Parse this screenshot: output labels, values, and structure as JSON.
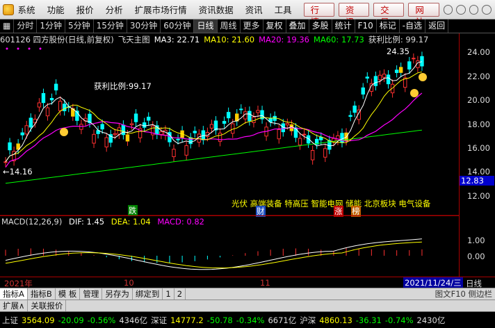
{
  "menu": {
    "items": [
      "系统",
      "功能",
      "报价",
      "分析",
      "扩展市场行情",
      "资讯数据",
      "资讯",
      "工具"
    ],
    "right_buttons": [
      "行情",
      "资讯",
      "交易",
      "网站"
    ]
  },
  "toolbar": {
    "left": [
      "分时",
      "1分钟",
      "5分钟",
      "15分钟",
      "30分钟",
      "60分钟",
      "日线",
      "周线",
      "更多"
    ],
    "active": "日线",
    "right": [
      "复权",
      "叠加",
      "多股",
      "统计",
      "F10",
      "标记",
      "-自选",
      "返回"
    ]
  },
  "info": {
    "stock": "601126 四方股份(日线,前复权)",
    "main_label": "飞天主图",
    "ma3": "MA3: 22.71",
    "ma10": "MA10: 21.60",
    "ma20": "MA20: 19.36",
    "ma60": "MA60: 17.73",
    "profit": "获利比例: 99.17"
  },
  "axis": {
    "y_labels": [
      "24.00",
      "22.00",
      "20.00",
      "18.00",
      "16.00",
      "14.00",
      "12.00"
    ],
    "current_price": "12.83",
    "macd_labels": [
      "1.00",
      "0.00"
    ]
  },
  "annotations": {
    "profit_mid": "获利比例:99.17",
    "low_price": "←14.16",
    "high_price": "24.35",
    "sectors": "光伏 高端装备 特高压 智能电网 储能  北京板块   电气设备",
    "tag_die": "跌",
    "tag_cai": "财",
    "tag_zhang": "涨",
    "tag_bang": "榜"
  },
  "macd": {
    "label": "MACD(12,26,9)",
    "dif": "DIF: 1.45",
    "dea": "DEA: 1.04",
    "macd": "MACD: 0.82"
  },
  "dates": {
    "start": "2021年",
    "m10": "10",
    "m11": "11",
    "current": "2021/11/24/三",
    "period": "日线"
  },
  "tabs": {
    "items": [
      "指标A",
      "指标B",
      "模 板",
      "管理",
      "另存为",
      "绑定到",
      "1",
      "2"
    ],
    "active": "指标A",
    "right_text": "图文F10 侧边栏"
  },
  "tabs2": [
    "扩展∧",
    "关联报价"
  ],
  "status": {
    "sh_label": "上证",
    "sh_price": "3564.09",
    "sh_chg": "-20.09",
    "sh_pct": "-0.56%",
    "sh_vol": "4346亿",
    "sz_label": "深证",
    "sz_price": "14777.2",
    "sz_chg": "-50.78",
    "sz_pct": "-0.34%",
    "sz_vol": "6671亿",
    "hs_label": "沪深",
    "hs_price": "4860.13",
    "hs_chg": "-36.31",
    "hs_pct": "-0.74%",
    "hs_vol": "2430亿"
  },
  "colors": {
    "up": "#ff3030",
    "down": "#00ffff",
    "ma3": "#ffffff",
    "ma10": "#ffff00",
    "ma20": "#ff00ff",
    "ma60": "#00ff00"
  }
}
